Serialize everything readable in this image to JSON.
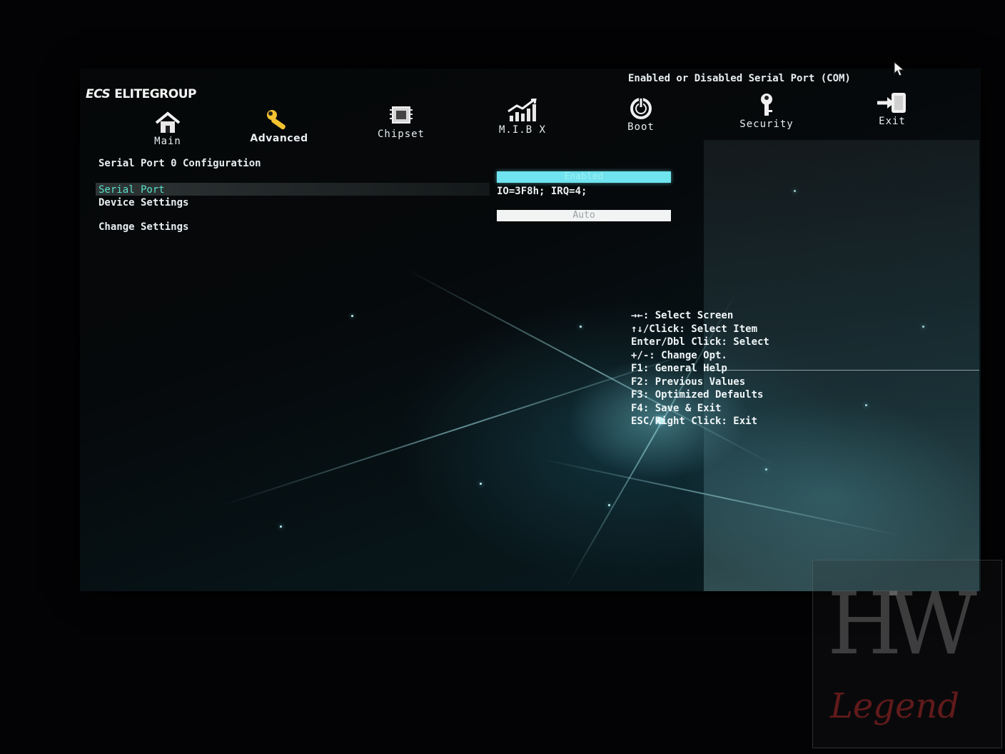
{
  "brand": {
    "mark": "ECS",
    "name": "ELITEGROUP"
  },
  "tabs": [
    {
      "label": "Main",
      "icon": "home-icon",
      "active": false
    },
    {
      "label": "Advanced",
      "icon": "wrench-icon",
      "active": true
    },
    {
      "label": "Chipset",
      "icon": "chip-icon",
      "active": false
    },
    {
      "label": "M.I.B X",
      "icon": "chart-up-icon",
      "active": false
    },
    {
      "label": "Boot",
      "icon": "power-icon",
      "active": false
    },
    {
      "label": "Security",
      "icon": "key-icon",
      "active": false
    },
    {
      "label": "Exit",
      "icon": "exit-door-icon",
      "active": false
    }
  ],
  "page": {
    "title": "Serial Port 0 Configuration",
    "rows": [
      {
        "label": "Serial Port",
        "value": "Enabled",
        "selected": true
      },
      {
        "label": "Device Settings",
        "value": "IO=3F8h; IRQ=4;"
      },
      {
        "label": "Change Settings",
        "value": "Auto"
      }
    ]
  },
  "help": {
    "description": "Enabled or Disabled Serial Port (COM)",
    "keys": [
      "→←: Select Screen",
      "↑↓/Click: Select Item",
      "Enter/Dbl Click: Select",
      "+/-: Change Opt.",
      "F1: General Help",
      "F2: Previous Values",
      "F3: Optimized Defaults",
      "F4: Save & Exit",
      "ESC/Right Click: Exit"
    ]
  },
  "watermark": {
    "top": "HW",
    "bottom": "Legend"
  },
  "colors": {
    "selected_text": "#58e0c8",
    "accent_bar": "#6fe3ee",
    "active_tab_icon": "#f2c230"
  }
}
